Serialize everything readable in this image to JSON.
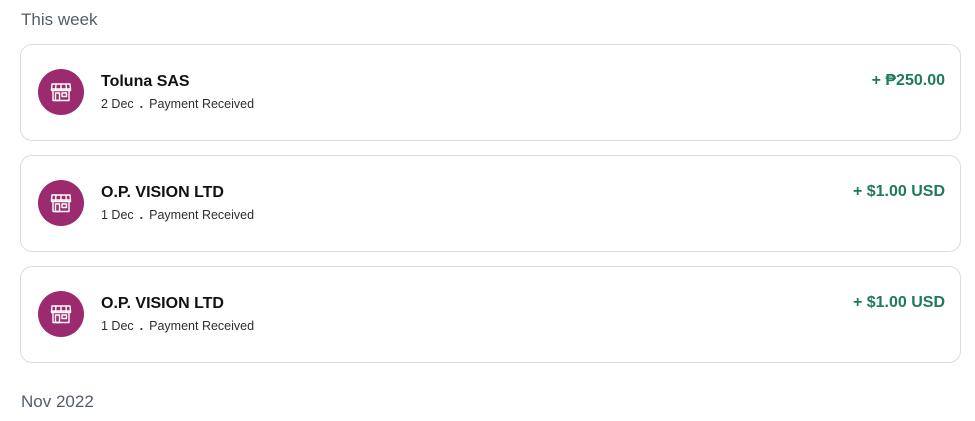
{
  "sections": [
    {
      "heading": "This week"
    },
    {
      "heading": "Nov 2022"
    }
  ],
  "transactions": [
    {
      "merchant": "Toluna SAS",
      "date": "2 Dec",
      "separator": ".",
      "status": "Payment Received",
      "amount": "+ ₱250.00",
      "icon": "storefront-icon"
    },
    {
      "merchant": "O.P. VISION LTD",
      "date": "1 Dec",
      "separator": ".",
      "status": "Payment Received",
      "amount": "+ $1.00 USD",
      "icon": "storefront-icon"
    },
    {
      "merchant": "O.P. VISION LTD",
      "date": "1 Dec",
      "separator": ".",
      "status": "Payment Received",
      "amount": "+ $1.00 USD",
      "icon": "storefront-icon"
    }
  ],
  "colors": {
    "avatar_bg": "#9c2a6f",
    "amount_positive": "#1e7a5b",
    "card_border": "#dcdcdc",
    "section_heading": "#545d68"
  }
}
